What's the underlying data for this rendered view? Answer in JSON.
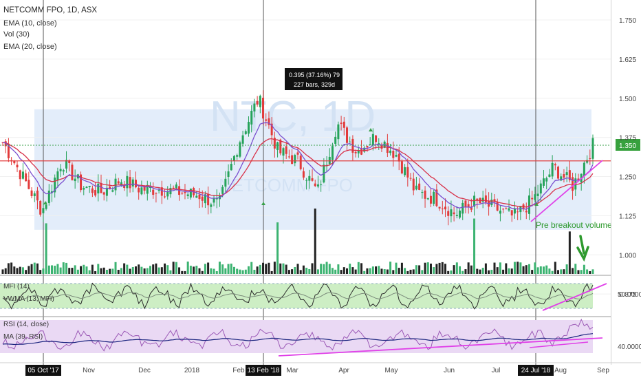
{
  "colors": {
    "up": "#26a35a",
    "down": "#e23b3b",
    "ema10": "#d8324a",
    "ema20": "#7a4fcf",
    "zone": "#e3edfa",
    "resistance": "#e23b3b",
    "trendline": "#e040e8",
    "mfi_bg": "#cdeec4",
    "rsi_bg": "#ead9f4",
    "label_bg": "#37a13d",
    "annotation": "#2e9a2e"
  },
  "header": {
    "title": "NETCOMM FPO, 1D, ASX",
    "indicators": [
      "EMA (10, close)",
      "Vol (30)",
      "EMA (20, close)"
    ]
  },
  "watermark": {
    "symbol": "NTC, 1D",
    "name": "NETCOMM FPO"
  },
  "measure_tooltip": {
    "line1": "0.395 (37.16%) 79",
    "line2": "227 bars, 329d"
  },
  "last_price_label": "1.350",
  "annotation": {
    "text": "Pre breakout volume",
    "icon": "arrow-down-icon"
  },
  "mfi_panel": {
    "labels": [
      "MFI (14)",
      "VWMA (13, MFI)"
    ],
    "scale_label": "50.0000"
  },
  "rsi_panel": {
    "labels": [
      "RSI (14, close)",
      "MA (39, RSI)"
    ],
    "scale_label": "40.0000"
  },
  "time_axis": {
    "labels": [
      "Nov",
      "Dec",
      "2018",
      "Feb",
      "Mar",
      "Apr",
      "May",
      "Jun",
      "Jul",
      "Aug",
      "Sep"
    ],
    "highlighted": [
      "05 Oct '17",
      "13 Feb '18",
      "24 Jul '18"
    ]
  },
  "chart_data": {
    "type": "candlestick",
    "title": "NETCOMM FPO, 1D, ASX",
    "y_ticks": [
      "1.750",
      "1.625",
      "1.500",
      "1.375",
      "1.250",
      "1.125",
      "1.000",
      "0.875"
    ],
    "ylim": [
      0.82,
      1.8
    ],
    "resistance_level": 1.3,
    "last_price": 1.35,
    "zone": [
      1.08,
      1.465
    ],
    "x": [
      "05 Oct '17",
      "Nov",
      "Dec",
      "2018",
      "Feb",
      "13 Feb '18",
      "Mar",
      "Apr",
      "May",
      "Jun",
      "Jul",
      "24 Jul '18",
      "Aug",
      "Sep"
    ],
    "close_series": {
      "name": "close",
      "values": [
        1.36,
        1.25,
        1.14,
        1.3,
        1.22,
        1.2,
        1.24,
        1.21,
        1.21,
        1.2,
        1.19,
        1.16,
        1.36,
        1.5,
        1.33,
        1.3,
        1.2,
        1.42,
        1.33,
        1.38,
        1.32,
        1.2,
        1.18,
        1.13,
        1.17,
        1.15,
        1.12,
        1.18,
        1.28,
        1.22,
        1.35
      ]
    },
    "volume_peaks": [
      "05 Oct '17",
      "13 Feb '18",
      "Mar",
      "Jul",
      "Aug"
    ],
    "mfi_level": 50,
    "rsi_level": 40
  }
}
